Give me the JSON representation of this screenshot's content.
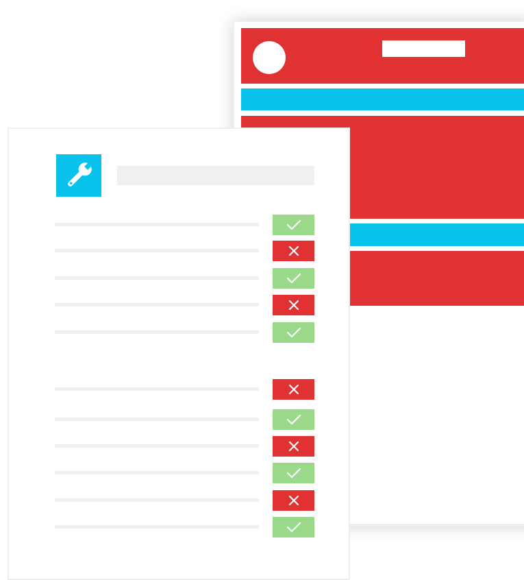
{
  "colors": {
    "accent_red": "#e03232",
    "accent_cyan": "#09c2ec",
    "pass_green": "#9ad98a",
    "fail_red": "#e03232",
    "placeholder_gray": "#f0f0f0"
  },
  "tool_tile": {
    "icon": "wrench-icon"
  },
  "checklist": {
    "group_1": [
      "pass",
      "fail",
      "pass",
      "fail",
      "pass"
    ],
    "group_2": [
      "fail",
      "pass",
      "fail",
      "pass",
      "fail",
      "pass"
    ]
  }
}
